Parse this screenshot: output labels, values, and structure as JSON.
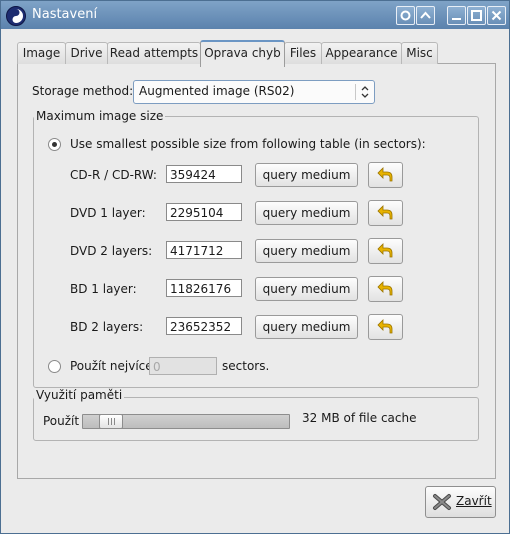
{
  "window": {
    "title": "Nastavení"
  },
  "tabs": [
    {
      "label": "Image"
    },
    {
      "label": "Drive"
    },
    {
      "label": "Read attempts"
    },
    {
      "label": "Oprava chyb",
      "active": true
    },
    {
      "label": "Files"
    },
    {
      "label": "Appearance"
    },
    {
      "label": "Misc"
    }
  ],
  "storage": {
    "label": "Storage method:",
    "value": "Augmented image (RS02)"
  },
  "max_size": {
    "legend": "Maximum image size",
    "option_table": "Use smallest possible size from following table (in sectors):",
    "rows": [
      {
        "label": "CD-R / CD-RW:",
        "value": "359424"
      },
      {
        "label": "DVD 1 layer:",
        "value": "2295104"
      },
      {
        "label": "DVD 2 layers:",
        "value": "4171712"
      },
      {
        "label": "BD 1 layer:",
        "value": "11826176"
      },
      {
        "label": "BD 2 layers:",
        "value": "23652352"
      }
    ],
    "query_label": "query medium",
    "option_custom": "Použít nejvíce",
    "custom_value": "0",
    "custom_unit": "sectors."
  },
  "memory": {
    "legend": "Využití paměti",
    "label": "Použít",
    "value_text": "32 MB of file cache",
    "slider_fraction": 0.12
  },
  "close_button": {
    "label": "Zavřít"
  },
  "colors": {
    "titlebar": "#6a8fb7",
    "undo_arrow": "#e8b300"
  }
}
